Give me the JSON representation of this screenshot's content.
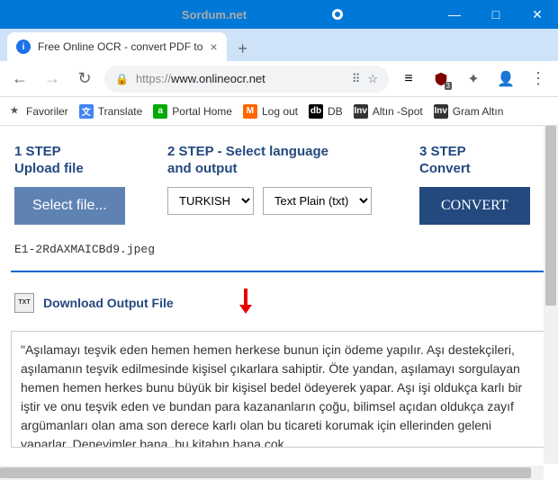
{
  "window": {
    "watermark": "Sordum.net",
    "min": "—",
    "max": "□",
    "close": "✕"
  },
  "tab": {
    "title": "Free Online OCR - convert PDF to",
    "favicon_letter": "i"
  },
  "nav": {
    "newtab": "+",
    "back": "←",
    "forward": "→",
    "reload": "↻",
    "menu": "⋮"
  },
  "address": {
    "lock": "🔒",
    "proto": "https://",
    "host": "www.onlineocr.net",
    "translate": "⠿",
    "star": "☆"
  },
  "ext": {
    "buffer": "≡",
    "ublock_badge": "3",
    "puzzle": "✦",
    "avatar": "👤"
  },
  "bookmarks": {
    "fav": "Favoriler",
    "translate": "Translate",
    "portal": "Portal Home",
    "logout": "Log out",
    "db": "DB",
    "altin": "Altın -Spot",
    "gram": "Gram Altın"
  },
  "steps": {
    "s1a": "1 STEP",
    "s1b": "Upload file",
    "s2a": "2 STEP - Select language",
    "s2b": "and output",
    "s3a": "3 STEP",
    "s3b": "Convert"
  },
  "buttons": {
    "select_file": "Select file...",
    "convert": "CONVERT"
  },
  "selects": {
    "language": "TURKISH",
    "output": "Text Plain (txt)"
  },
  "filename": "E1-2RdAXMAICBd9.jpeg",
  "download": {
    "label": "Download Output File",
    "icon_text": "TXT"
  },
  "output_text": "\"Aşılamayı teşvik eden hemen hemen herkese bunun için ödeme yapılır. Aşı destekçileri, aşılamanın teşvik edilmesinde kişisel çıkarlara sahiptir. Öte yandan, aşılamayı sorgulayan hemen hemen herkes bunu büyük bir kişisel bedel ödeyerek yapar. Aşı işi oldukça karlı bir iştir ve onu teşvik eden ve bundan para kazananların çoğu, bilimsel açıdan oldukça zayıf argümanları olan ama son derece karlı olan bu ticareti korumak için ellerinden geleni yaparlar. Deneyimler bana, bu kitabın bana çok"
}
